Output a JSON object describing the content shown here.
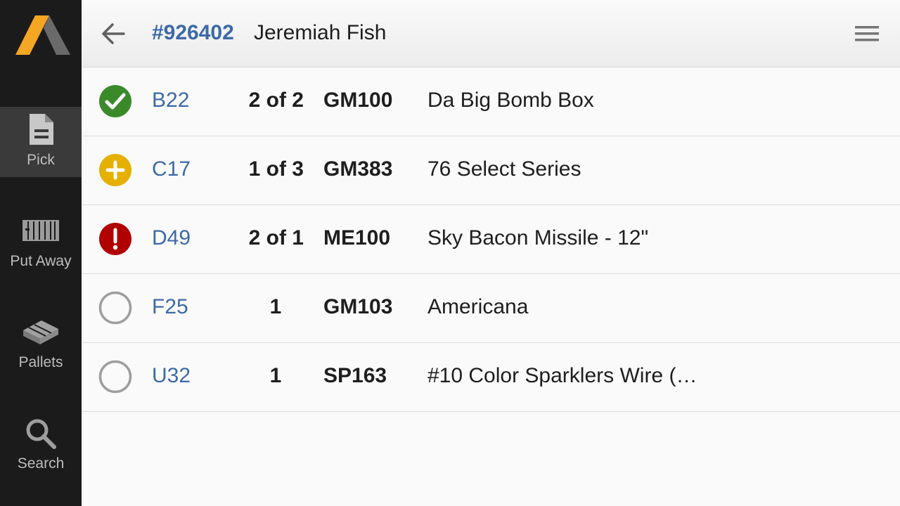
{
  "sidebar": {
    "logo": "app-logo",
    "items": [
      {
        "label": "Pick",
        "icon": "document-icon",
        "active": true
      },
      {
        "label": "Put Away",
        "icon": "container-icon",
        "active": false
      },
      {
        "label": "Pallets",
        "icon": "pallet-icon",
        "active": false
      },
      {
        "label": "Search",
        "icon": "search-icon",
        "active": false
      }
    ]
  },
  "header": {
    "order_number": "#926402",
    "customer_name": "Jeremiah Fish",
    "back_icon": "arrow-left-icon",
    "menu_icon": "hamburger-menu-icon"
  },
  "colors": {
    "accent": "#f5a623",
    "link": "#3d6aa6",
    "complete": "#3a8a2a",
    "partial": "#e6b000",
    "error": "#b10000",
    "pending": "#9e9e9e"
  },
  "picks": [
    {
      "status": "complete",
      "location": "B22",
      "quantity": "2 of 2",
      "sku": "GM100",
      "description": "Da Big Bomb Box"
    },
    {
      "status": "partial",
      "location": "C17",
      "quantity": "1 of 3",
      "sku": "GM383",
      "description": "76 Select Series"
    },
    {
      "status": "error",
      "location": "D49",
      "quantity": "2 of 1",
      "sku": "ME100",
      "description": "Sky Bacon Missile - 12\""
    },
    {
      "status": "pending",
      "location": "F25",
      "quantity": "1",
      "sku": "GM103",
      "description": "Americana"
    },
    {
      "status": "pending",
      "location": "U32",
      "quantity": "1",
      "sku": "SP163",
      "description": "#10 Color Sparklers Wire (…"
    }
  ]
}
